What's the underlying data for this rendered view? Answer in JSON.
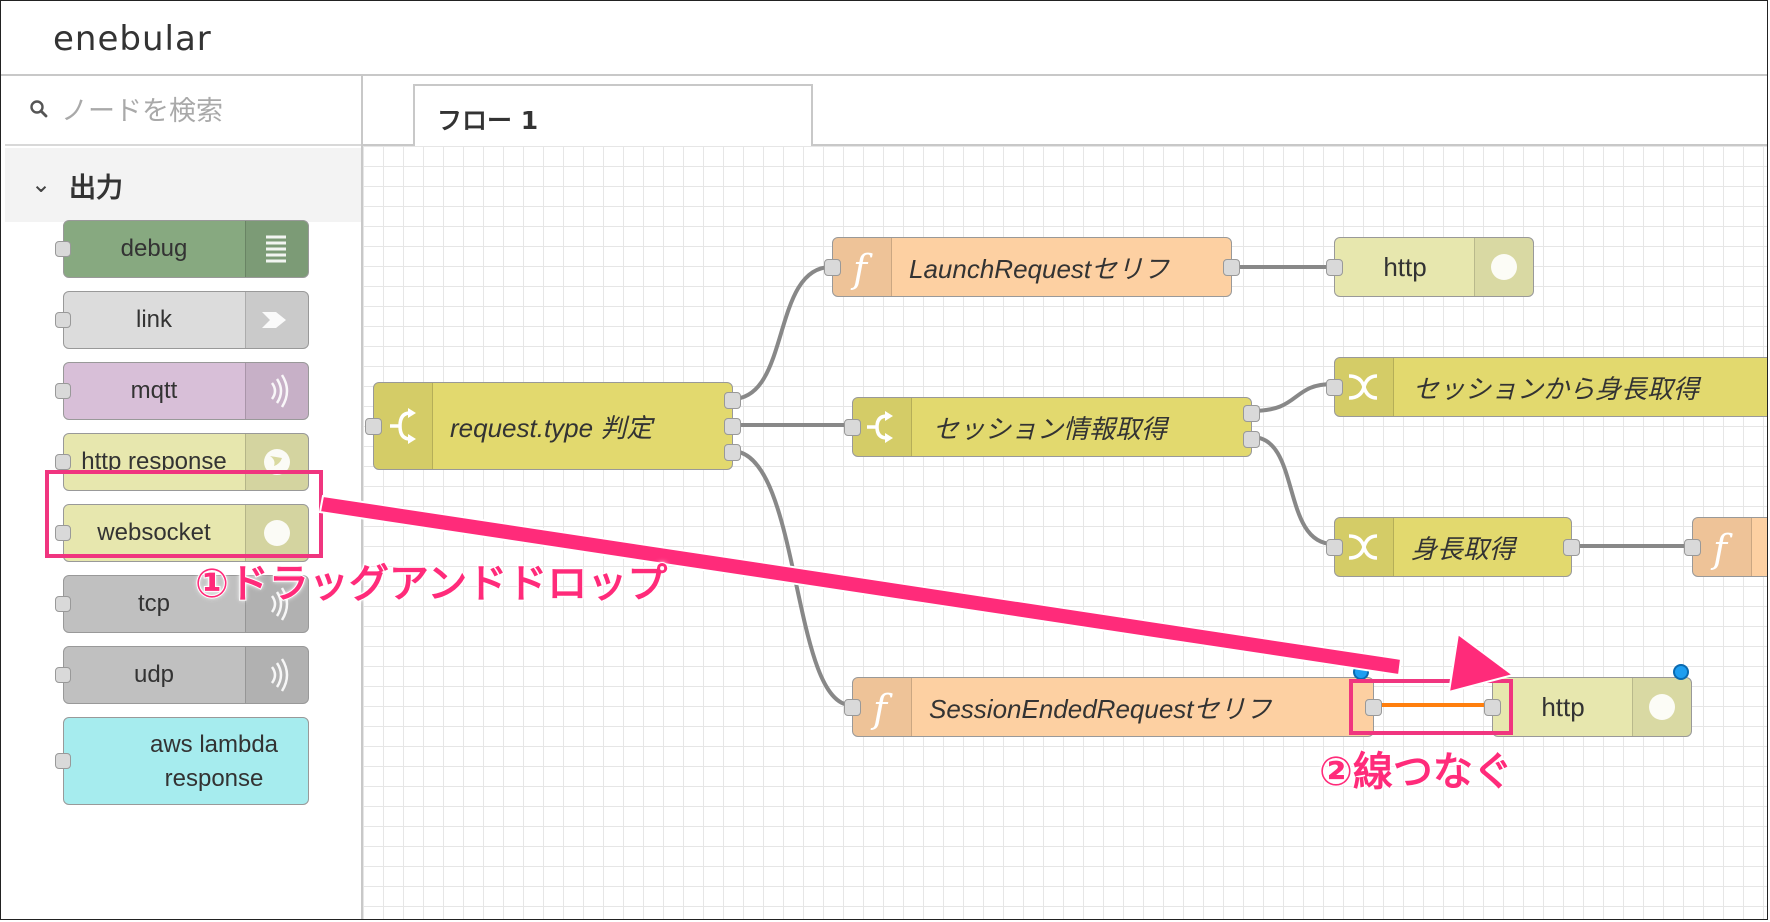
{
  "app": {
    "logo": "enebular"
  },
  "palette": {
    "search_placeholder": "ノードを検索",
    "category": "出力",
    "nodes": [
      {
        "label": "debug",
        "icon": "list-icon"
      },
      {
        "label": "link",
        "icon": "link-out-icon"
      },
      {
        "label": "mqtt",
        "icon": "radio-wave-icon"
      },
      {
        "label": "http response",
        "icon": "globe-icon"
      },
      {
        "label": "websocket",
        "icon": "globe-icon"
      },
      {
        "label": "tcp",
        "icon": "radio-wave-icon"
      },
      {
        "label": "udp",
        "icon": "radio-wave-icon"
      },
      {
        "label_line1": "aws lambda",
        "label_line2": "response"
      }
    ]
  },
  "tabs": [
    {
      "label": "フロー 1"
    }
  ],
  "flow": {
    "nodes": [
      {
        "id": "switch1",
        "label": "request.type 判定",
        "type": "switch"
      },
      {
        "id": "fn_launch",
        "label": "LaunchRequestセリフ",
        "type": "function"
      },
      {
        "id": "http1",
        "label": "http",
        "type": "http response"
      },
      {
        "id": "switch2",
        "label": "セッション情報取得",
        "type": "switch"
      },
      {
        "id": "change1",
        "label": "セッションから身長取得",
        "type": "change"
      },
      {
        "id": "change2",
        "label": "身長取得",
        "type": "change"
      },
      {
        "id": "fn_session_end",
        "label": "SessionEndedRequestセリフ",
        "type": "function"
      },
      {
        "id": "http2",
        "label": "http",
        "type": "http response"
      }
    ]
  },
  "annotations": {
    "step1": "①ドラッグアンドドロップ",
    "step2": "②線つなぐ"
  },
  "colors": {
    "annotation": "#ff2b7a",
    "switch": "#e2d96e",
    "function": "#fdd0a2",
    "http": "#e7e7ae",
    "debug": "#87a980",
    "wire_selected": "#ff7f0e"
  }
}
